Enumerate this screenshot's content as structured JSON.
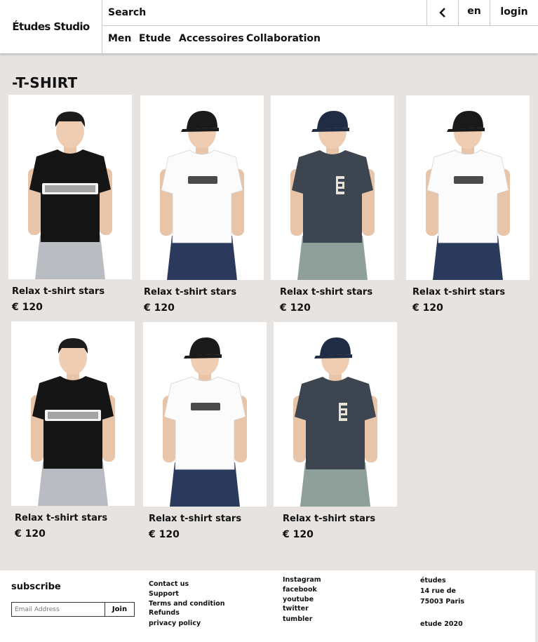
{
  "header": {
    "logo": "Études Studio",
    "search_placeholder": "Search",
    "lang": "en",
    "login": "login",
    "nav": [
      "Men",
      "Etude",
      "Accessoires",
      "Collaboration"
    ]
  },
  "page_title": "-T-SHIRT",
  "products": [
    {
      "name": "Relax t-shirt stars",
      "price": "€ 120",
      "shirt": "black",
      "cap": "none"
    },
    {
      "name": "Relax t-shirt stars",
      "price": "€ 120",
      "shirt": "white",
      "cap": "black"
    },
    {
      "name": "Relax t-shirt stars",
      "price": "€ 120",
      "shirt": "charcoal",
      "cap": "navy"
    },
    {
      "name": "Relax t-shirt stars",
      "price": "€ 120",
      "shirt": "white",
      "cap": "black"
    },
    {
      "name": "Relax t-shirt stars",
      "price": "€ 120",
      "shirt": "black",
      "cap": "none"
    },
    {
      "name": "Relax t-shirt stars",
      "price": "€ 120",
      "shirt": "white",
      "cap": "black"
    },
    {
      "name": "Relax t-shirt stars",
      "price": "€ 120",
      "shirt": "charcoal",
      "cap": "navy"
    }
  ],
  "footer": {
    "subscribe_title": "subscribe",
    "email_placeholder": "Email Address",
    "join": "Join",
    "info_links": [
      "Contact us",
      "Support",
      "Terms and condition",
      "Refunds",
      "privacy policy"
    ],
    "social_links": [
      "Instagram",
      "facebook",
      "youtube",
      "twitter",
      "tumbler"
    ],
    "address": [
      "études",
      "14 rue de",
      "75003 Paris"
    ],
    "copyright": "etude 2020"
  },
  "colors": {
    "background": "#e6e3e1",
    "header_bg": "#ffffff",
    "text": "#111111"
  }
}
